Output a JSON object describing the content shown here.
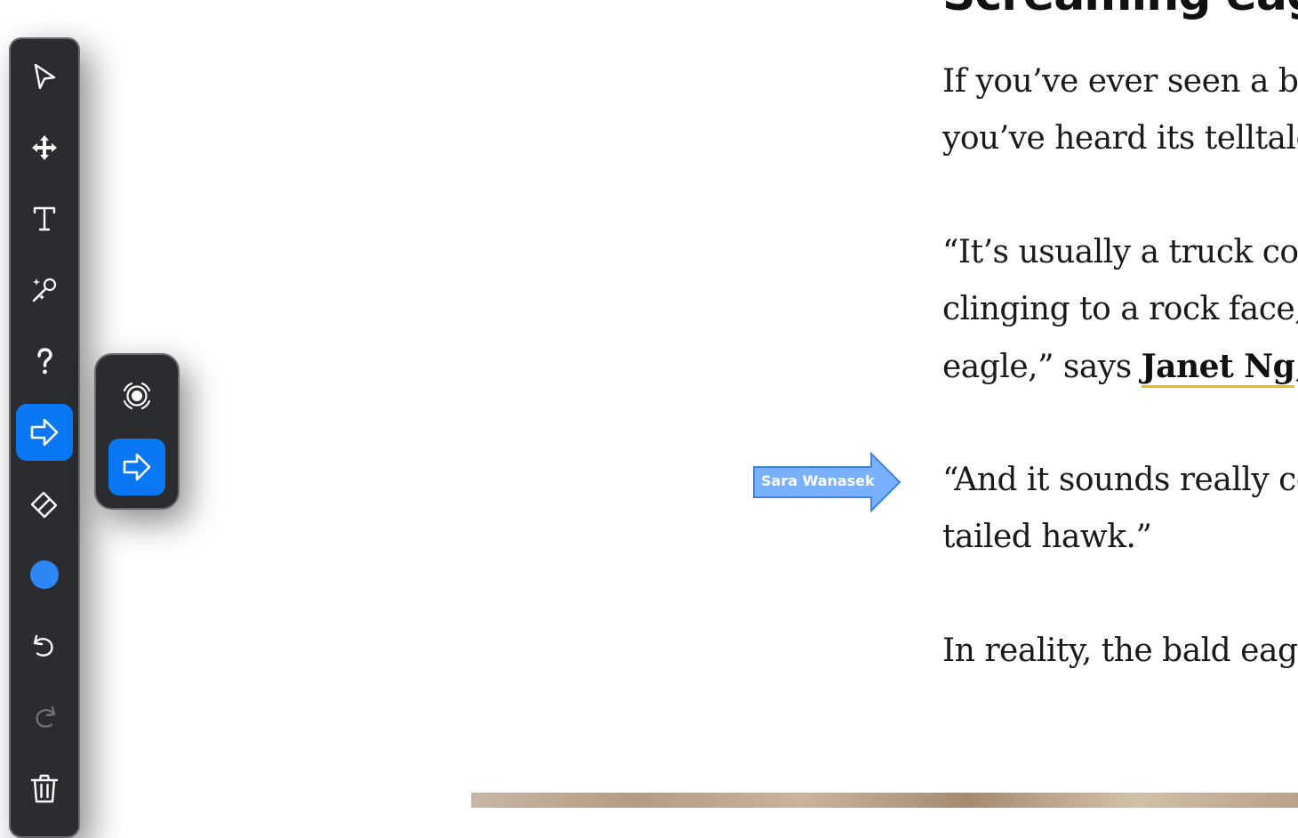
{
  "article": {
    "heading": "Screaming eagl",
    "paragraphs": [
      {
        "lines": [
          "If you’ve ever seen a bal",
          "you’ve heard its telltale "
        ]
      },
      {
        "lines": [
          "“It’s usually a truck com",
          "clinging to a rock face, a"
        ],
        "line3_before": "eagle,” says ",
        "link_text": "Janet Ng",
        "line3_after": ", a"
      },
      {
        "lines": [
          "“And it sounds really co",
          "tailed hawk.”"
        ]
      },
      {
        "lines": [
          "In reality, the bald eagle"
        ]
      }
    ]
  },
  "annotation": {
    "label": "Sara Wanasek",
    "color": "#79b0ff",
    "border_color": "#3d82e8"
  },
  "toolbar": {
    "accent": "#0a78f2",
    "tools": [
      {
        "icon": "cursor-icon",
        "active": false
      },
      {
        "icon": "move-icon",
        "active": false
      },
      {
        "icon": "text-icon",
        "active": false
      },
      {
        "icon": "magic-wand-icon",
        "active": false
      },
      {
        "icon": "question-icon",
        "active": false
      },
      {
        "icon": "arrow-icon",
        "active": true
      },
      {
        "icon": "eraser-icon",
        "active": false
      },
      {
        "icon": "color-dot-icon",
        "active": false,
        "color": "#2d88f5"
      },
      {
        "icon": "undo-icon",
        "active": false
      },
      {
        "icon": "redo-icon",
        "active": false,
        "disabled": true
      },
      {
        "icon": "trash-icon",
        "active": false
      }
    ],
    "subpanel": [
      {
        "icon": "spotlight-icon",
        "active": false
      },
      {
        "icon": "arrow-icon",
        "active": true
      }
    ]
  }
}
